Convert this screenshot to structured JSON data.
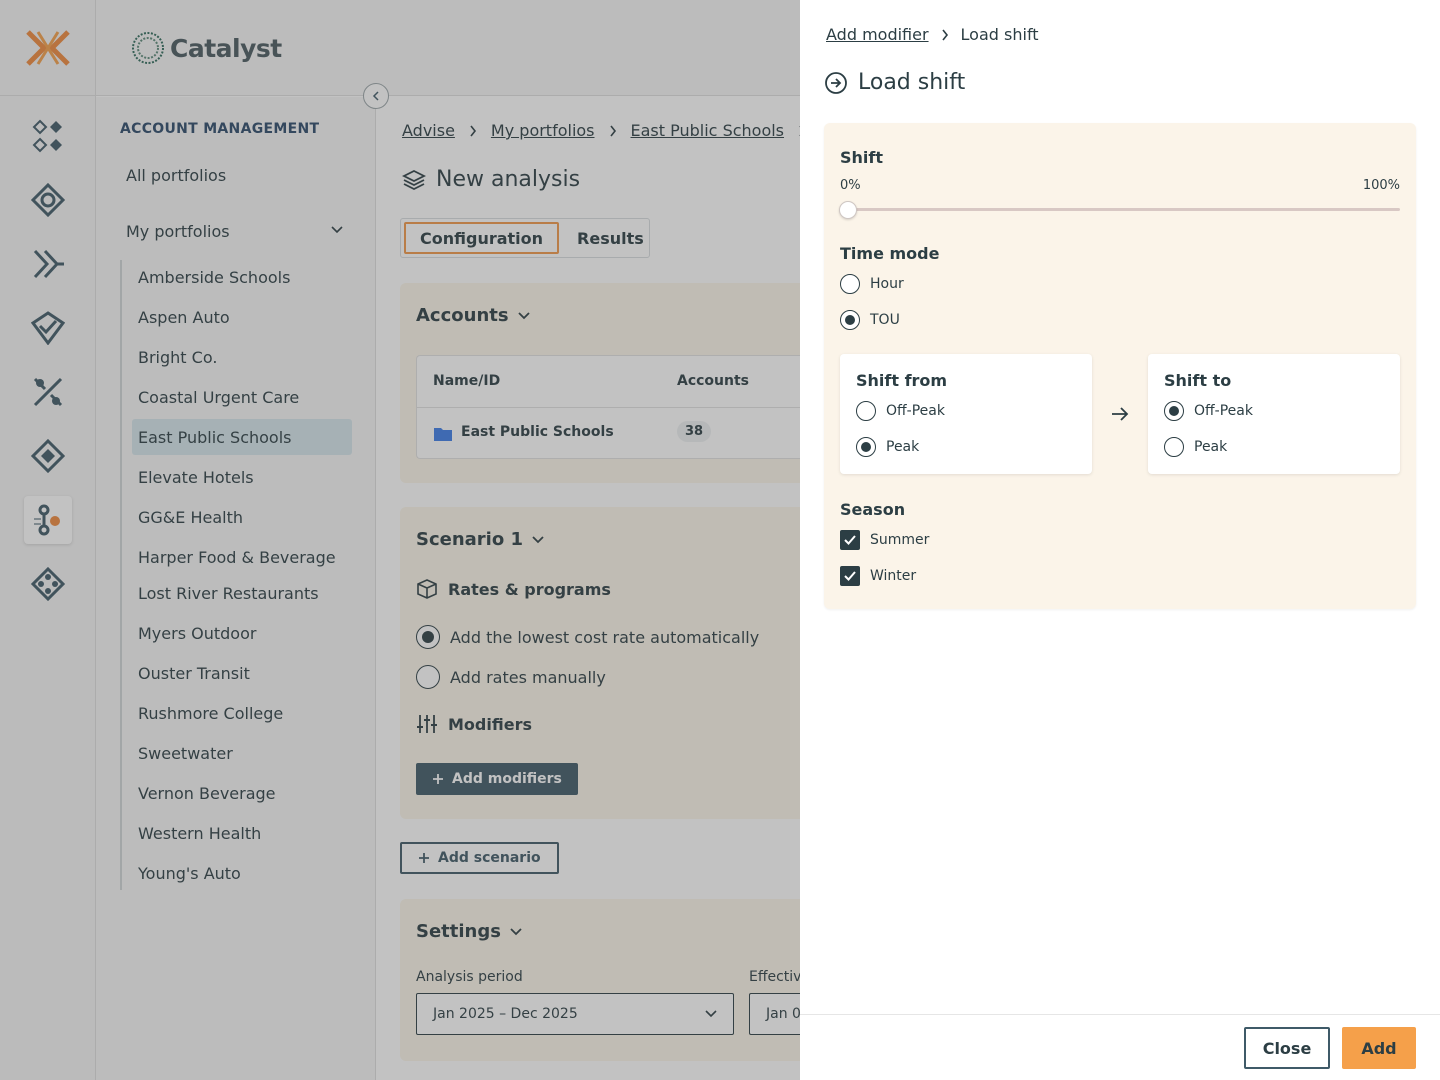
{
  "colors": {
    "accent": "#f5a04a",
    "brand_dark": "#3f5a68",
    "card_bg": "#fdf6ea",
    "selected_item_bg": "#d6e6ec"
  },
  "brand": {
    "name": "Catalyst"
  },
  "rail": {
    "items": [
      "grid-diamonds-icon",
      "target-icon",
      "flow-icon",
      "check-shield-icon",
      "people-network-icon",
      "diamond-icon",
      "tools-icon",
      "network-icon"
    ]
  },
  "sidebar": {
    "heading": "ACCOUNT MANAGEMENT",
    "all_portfolios": "All portfolios",
    "my_portfolios": "My portfolios",
    "items": [
      {
        "label": "Amberside Schools"
      },
      {
        "label": "Aspen Auto"
      },
      {
        "label": "Bright Co."
      },
      {
        "label": "Coastal Urgent Care"
      },
      {
        "label": "East Public Schools"
      },
      {
        "label": "Elevate Hotels"
      },
      {
        "label": "GG&E Health"
      },
      {
        "label": "Harper Food & Beverage"
      },
      {
        "label": "Lost River Restaurants"
      },
      {
        "label": "Myers Outdoor"
      },
      {
        "label": "Ouster Transit"
      },
      {
        "label": "Rushmore College"
      },
      {
        "label": "Sweetwater"
      },
      {
        "label": "Vernon Beverage"
      },
      {
        "label": "Western Health"
      },
      {
        "label": "Young's Auto"
      }
    ]
  },
  "main": {
    "breadcrumbs": [
      "Advise",
      "My portfolios",
      "East Public Schools"
    ],
    "title": "New analysis",
    "tabs": [
      {
        "label": "Configuration"
      },
      {
        "label": "Results"
      }
    ],
    "accounts": {
      "title": "Accounts",
      "columns": [
        "Name/ID",
        "Accounts"
      ],
      "rows": [
        {
          "name": "East Public Schools",
          "accounts": "38"
        }
      ]
    },
    "scenario": {
      "title": "Scenario 1",
      "rates_title": "Rates & programs",
      "options": [
        "Add the lowest cost rate automatically",
        "Add rates manually"
      ],
      "modifiers_title": "Modifiers",
      "add_modifiers": "Add modifiers"
    },
    "add_scenario": "Add scenario",
    "settings": {
      "title": "Settings",
      "analysis_period_label": "Analysis period",
      "analysis_period_value": "Jan 2025 – Dec 2025",
      "effective_label": "Effectiv",
      "effective_value": "Jan 0"
    }
  },
  "panel": {
    "breadcrumb_parent": "Add modifier",
    "breadcrumb_current": "Load shift",
    "title": "Load shift",
    "shift": {
      "label": "Shift",
      "min_label": "0%",
      "max_label": "100%",
      "value": 0
    },
    "time_mode": {
      "label": "Time mode",
      "options": [
        "Hour",
        "TOU"
      ],
      "selected": "TOU"
    },
    "shift_from": {
      "label": "Shift from",
      "options": [
        "Off-Peak",
        "Peak"
      ],
      "selected": "Peak"
    },
    "shift_to": {
      "label": "Shift to",
      "options": [
        "Off-Peak",
        "Peak"
      ],
      "selected": "Off-Peak"
    },
    "season": {
      "label": "Season",
      "options": [
        "Summer",
        "Winter"
      ],
      "checked": [
        "Summer",
        "Winter"
      ]
    },
    "close_label": "Close",
    "add_label": "Add"
  }
}
